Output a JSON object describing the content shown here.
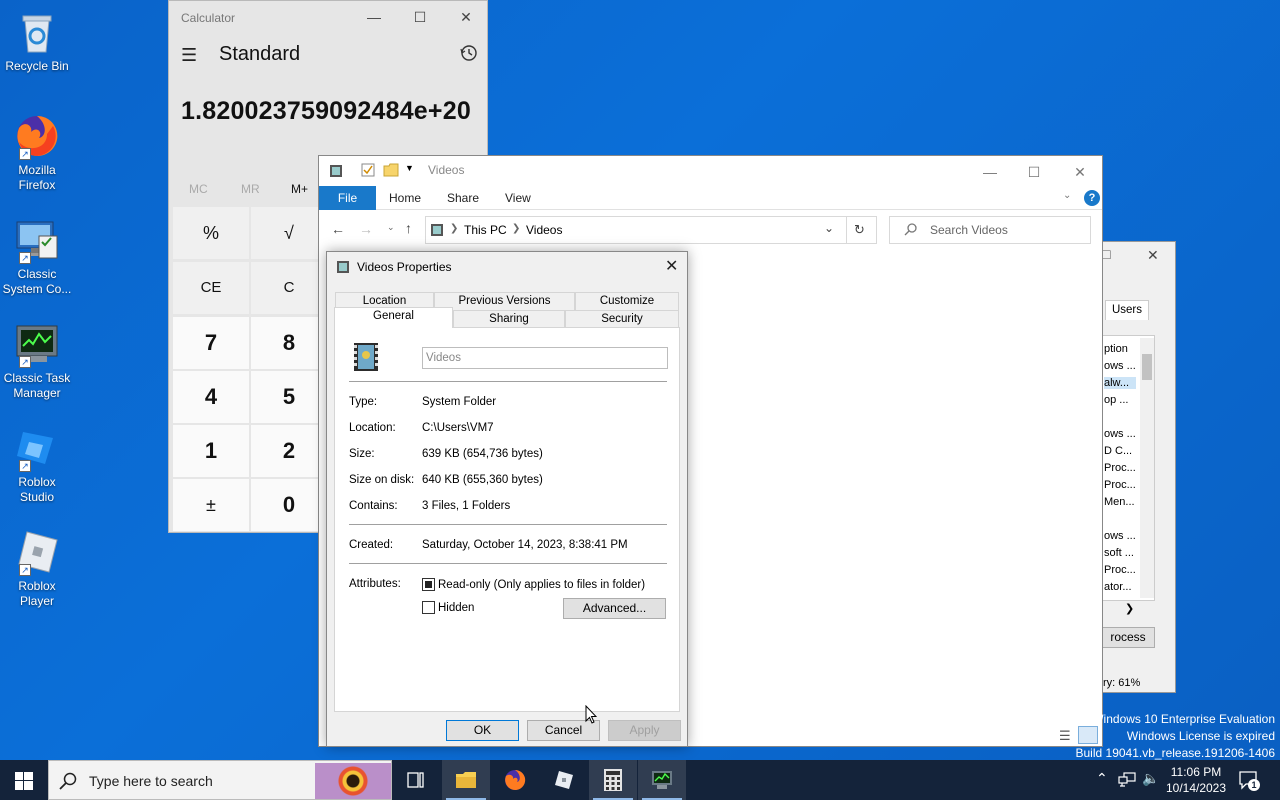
{
  "desktop": {
    "icons": [
      {
        "label": "Recycle Bin",
        "icon": "recycle-bin-icon"
      },
      {
        "label": "Mozilla Firefox",
        "icon": "firefox-icon"
      },
      {
        "label": "Classic System Co...",
        "icon": "control-panel-icon"
      },
      {
        "label": "Classic Task Manager",
        "icon": "task-manager-icon"
      },
      {
        "label": "Roblox Studio",
        "icon": "roblox-studio-icon"
      },
      {
        "label": "Roblox Player",
        "icon": "roblox-player-icon"
      }
    ],
    "watermark": {
      "line1": "Windows 10 Enterprise Evaluation",
      "line2": "Windows License is expired",
      "line3": "Build 19041.vb_release.191206-1406"
    }
  },
  "calculator": {
    "title": "Calculator",
    "mode": "Standard",
    "display": "1.820023759092484e+20",
    "memory": [
      "MC",
      "MR",
      "M+"
    ],
    "keys": [
      [
        "%",
        "√"
      ],
      [
        "CE",
        "C"
      ],
      [
        "7",
        "8"
      ],
      [
        "4",
        "5"
      ],
      [
        "1",
        "2"
      ],
      [
        "±",
        "0"
      ]
    ]
  },
  "explorer": {
    "title": "Videos",
    "tabs": [
      "File",
      "Home",
      "Share",
      "View"
    ],
    "breadcrumb": [
      "This PC",
      "Videos"
    ],
    "search_placeholder": "Search Videos"
  },
  "taskmgr": {
    "tab": "Users",
    "rows": [
      "ption",
      "ows ...",
      "alw...",
      "op ...",
      "",
      "ows ...",
      "D C...",
      "Proc...",
      "Proc...",
      "Men...",
      "",
      "ows ...",
      "soft ...",
      "Proc...",
      "ator..."
    ],
    "button": "rocess",
    "status": "ry: 61%"
  },
  "props": {
    "title": "Videos Properties",
    "tabs_top": [
      "Location",
      "Previous Versions",
      "Customize"
    ],
    "tabs_bottom": [
      "General",
      "Sharing",
      "Security"
    ],
    "name_field": "Videos",
    "fields": [
      {
        "label": "Type:",
        "value": "System Folder"
      },
      {
        "label": "Location:",
        "value": "C:\\Users\\VM7"
      },
      {
        "label": "Size:",
        "value": "639 KB (654,736 bytes)"
      },
      {
        "label": "Size on disk:",
        "value": "640 KB (655,360 bytes)"
      },
      {
        "label": "Contains:",
        "value": "3 Files, 1 Folders"
      }
    ],
    "created_label": "Created:",
    "created_value": "Saturday, October 14, 2023, 8:38:41 PM",
    "attributes_label": "Attributes:",
    "readonly_label": "Read-only (Only applies to files in folder)",
    "hidden_label": "Hidden",
    "advanced_label": "Advanced...",
    "ok": "OK",
    "cancel": "Cancel",
    "apply": "Apply"
  },
  "taskbar": {
    "search_placeholder": "Type here to search",
    "time": "11:06 PM",
    "date": "10/14/2023",
    "notification_count": "1"
  },
  "colors": {
    "accent": "#1979ca",
    "desktop": "#0b6fd8",
    "taskbar": "#14233a"
  }
}
